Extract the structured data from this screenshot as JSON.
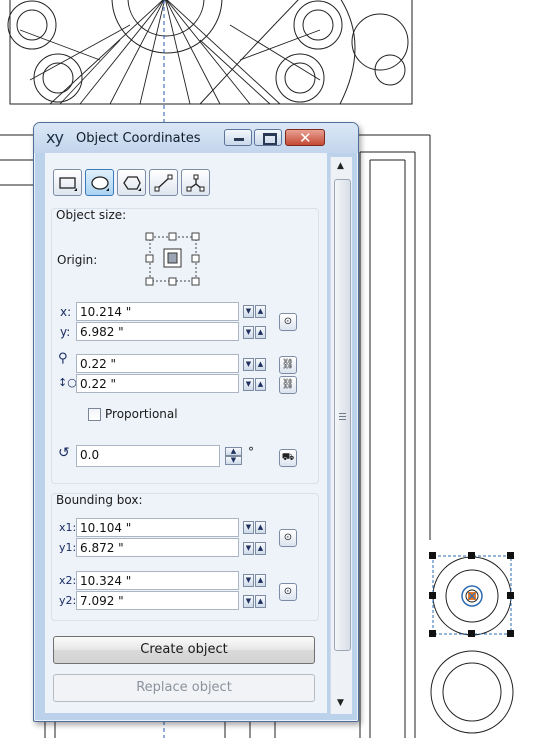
{
  "window": {
    "icon": "xy",
    "title": "Object Coordinates",
    "buttons": [
      "minimize",
      "maximize",
      "close"
    ]
  },
  "shape_tools": [
    {
      "name": "rectangle-tool",
      "active": false
    },
    {
      "name": "ellipse-tool",
      "active": true
    },
    {
      "name": "polygon-tool",
      "active": false
    },
    {
      "name": "line-tool",
      "active": false
    },
    {
      "name": "curve-tool",
      "active": false
    }
  ],
  "object_size": {
    "title": "Object size:",
    "origin_label": "Origin:",
    "x_label": "x:",
    "x_value": "10.214 \"",
    "y_label": "y:",
    "y_value": "6.982 \"",
    "width_value": "0.22 \"",
    "height_value": "0.22 \"",
    "proportional_label": "Proportional",
    "proportional_checked": false,
    "angle_value": "0.0",
    "angle_unit": "°"
  },
  "bounding_box": {
    "title": "Bounding box:",
    "x1_label": "x1:",
    "x1_value": "10.104 \"",
    "y1_label": "y1:",
    "y1_value": "6.872 \"",
    "x2_label": "x2:",
    "x2_value": "10.324 \"",
    "y2_label": "y2:",
    "y2_value": "7.092 \""
  },
  "actions": {
    "create_label": "Create object",
    "replace_label": "Replace object"
  },
  "colors": {
    "selection_blue": "#2b6cb3",
    "handle_orange": "#e07a2a",
    "title_bar": "#c2d5ec",
    "close_red": "#c44a35"
  }
}
